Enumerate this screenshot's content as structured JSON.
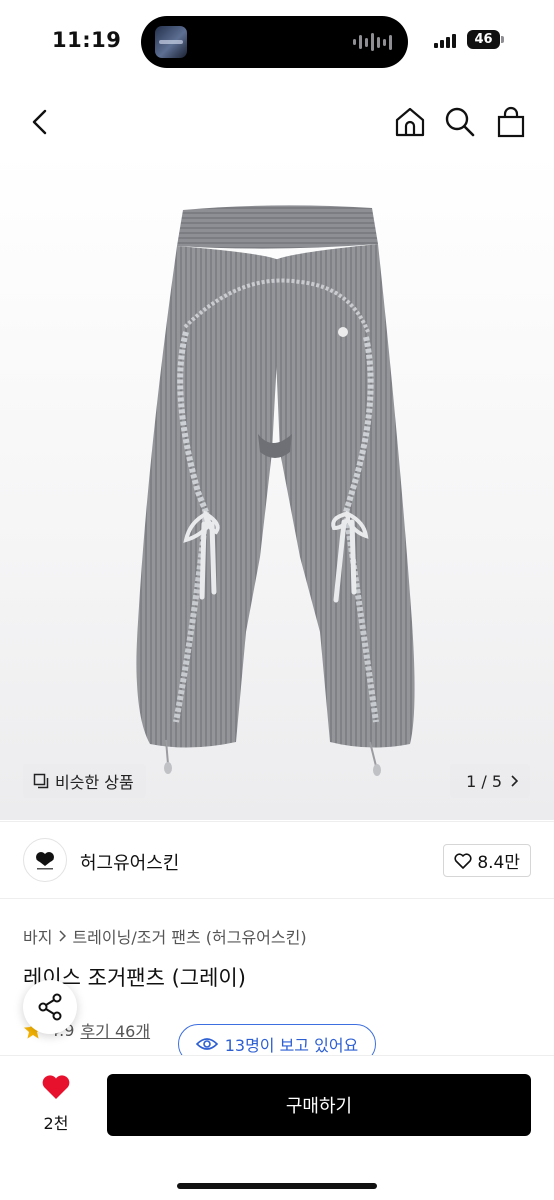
{
  "status_bar": {
    "time": "11:19",
    "battery": "46"
  },
  "icons": {
    "back": "chevron-left-icon",
    "home": "home-icon",
    "search": "search-icon",
    "bag": "shopping-bag-icon"
  },
  "gallery": {
    "similar_label": "비슷한 상품",
    "page_indicator": "1 / 5"
  },
  "brand": {
    "name": "허그유어스킨",
    "likes": "8.4만"
  },
  "product": {
    "breadcrumb": [
      "바지",
      "트레이닝/조거 팬츠 (허그유어스킨)"
    ],
    "title": "레이스 조거팬츠 (그레이)",
    "rating": "4.9",
    "reviews": "후기 46개",
    "viewers": "13명이 보고 있어요"
  },
  "bottom_bar": {
    "wish_count": "2천",
    "buy_label": "구매하기"
  },
  "colors": {
    "accent_blue": "#2d5fd3",
    "heart_red": "#e8112d",
    "star_yellow": "#f6b300",
    "pants_gray": "#8f9196"
  }
}
